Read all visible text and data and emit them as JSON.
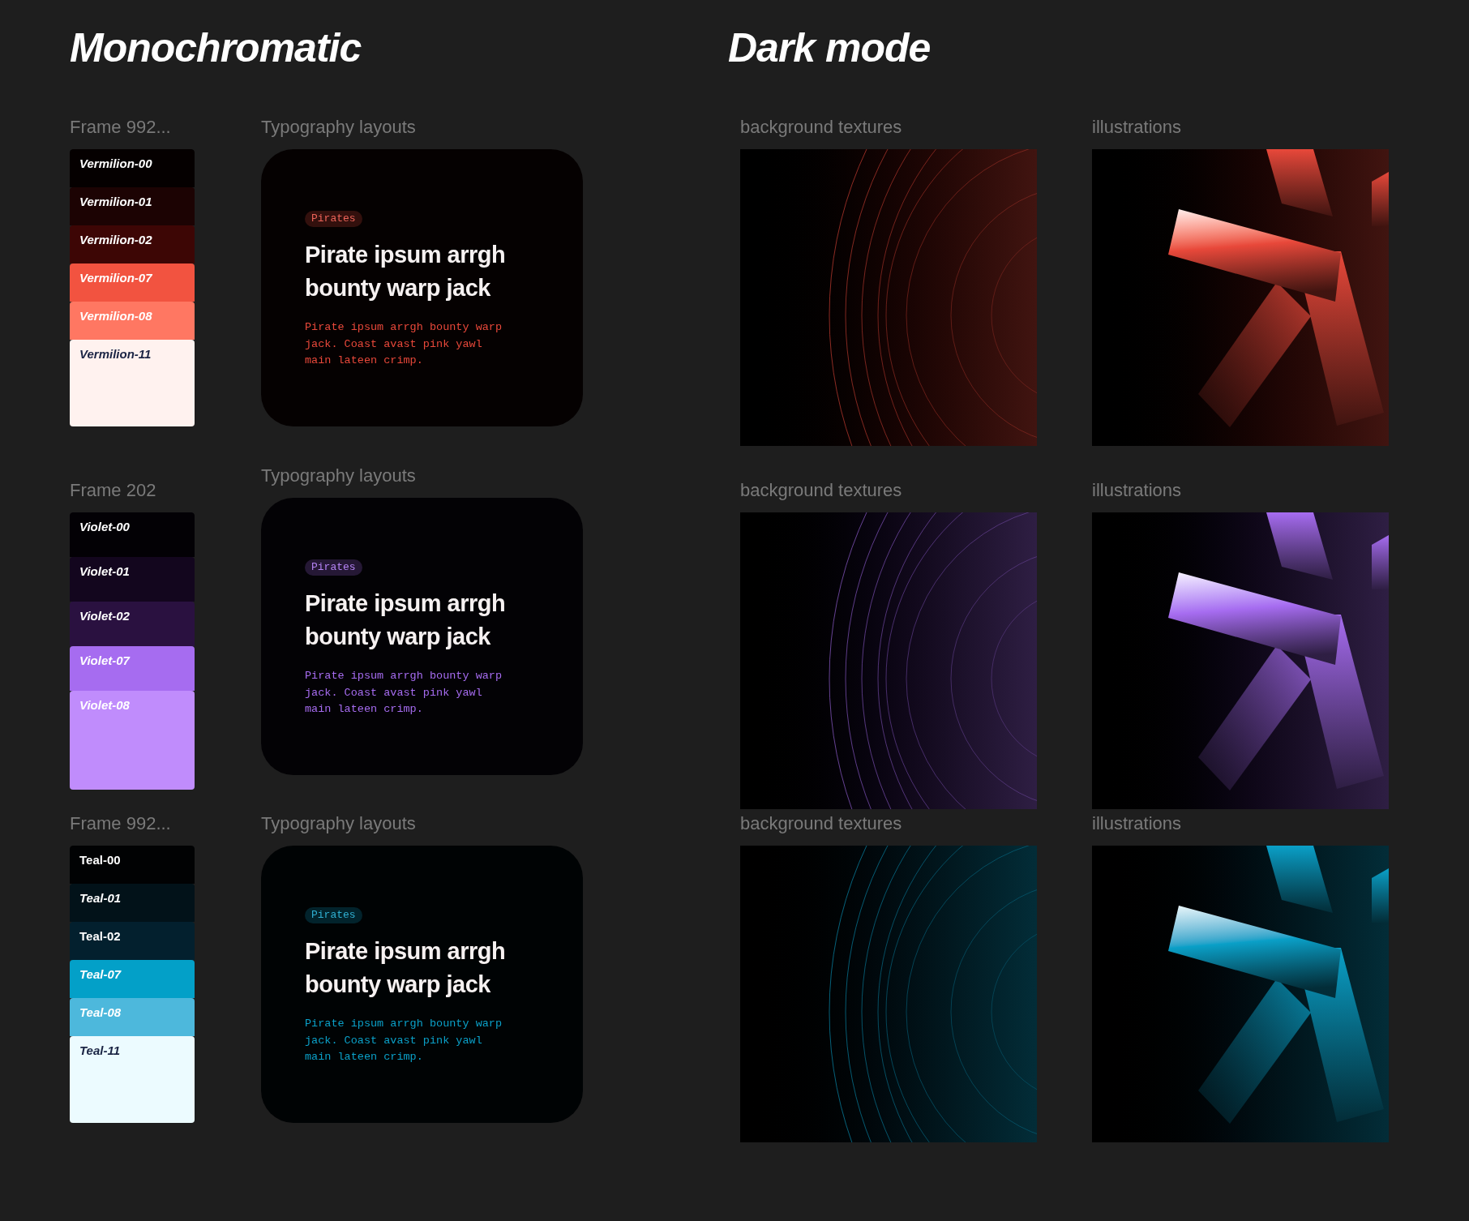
{
  "headings": [
    "Monochromatic",
    "Dark mode"
  ],
  "rows": [
    {
      "frame_label": "Frame 992...",
      "typography_label": "Typography layouts",
      "textures_label": "background textures",
      "illustrations_label": "illustrations",
      "color": "#e8483a",
      "swatches": [
        {
          "label": "Vermilion-00",
          "color": "#050000",
          "dark_label": false,
          "italic": true
        },
        {
          "label": "Vermilion-01",
          "color": "#1c0303",
          "dark_label": false,
          "italic": true
        },
        {
          "label": "Vermilion-02",
          "color": "#3d0605",
          "dark_label": false,
          "italic": true
        },
        {
          "label": "Vermilion-07",
          "color": "#f25340",
          "dark_label": false,
          "italic": true
        },
        {
          "label": "Vermilion-08",
          "color": "#ff7762",
          "dark_label": false,
          "italic": true
        },
        {
          "label": "Vermilion-11",
          "color": "#fff2ef",
          "dark_label": true,
          "italic": true
        }
      ],
      "card": {
        "tag": "Pirates",
        "heading": "Pirate ipsum arrgh bounty warp jack",
        "body": "Pirate ipsum arrgh bounty warp jack. Coast avast pink yawl main lateen crimp."
      }
    },
    {
      "frame_label": "Frame 202",
      "typography_label": "Typography layouts",
      "textures_label": "background textures",
      "illustrations_label": "illustrations",
      "color": "#a66cf0",
      "swatches": [
        {
          "label": "Violet-00",
          "color": "#030105",
          "dark_label": false,
          "italic": true
        },
        {
          "label": "Violet-01",
          "color": "#13061e",
          "dark_label": false,
          "italic": true
        },
        {
          "label": "Violet-02",
          "color": "#2a1140",
          "dark_label": false,
          "italic": true
        },
        {
          "label": "Violet-07",
          "color": "#a66cf0",
          "dark_label": false,
          "italic": true
        },
        {
          "label": "Violet-08",
          "color": "#c08cfc",
          "dark_label": false,
          "italic": true
        }
      ],
      "card": {
        "tag": "Pirates",
        "heading": "Pirate ipsum arrgh bounty warp jack",
        "body": "Pirate ipsum arrgh bounty warp jack. Coast avast pink yawl main lateen crimp."
      }
    },
    {
      "frame_label": "Frame 992...",
      "typography_label": "Typography layouts",
      "textures_label": "background textures",
      "illustrations_label": "illustrations",
      "color": "#0aa0c8",
      "swatches": [
        {
          "label": "Teal-00",
          "color": "#010203",
          "dark_label": false,
          "italic": false
        },
        {
          "label": "Teal-01",
          "color": "#021219",
          "dark_label": false,
          "italic": true
        },
        {
          "label": "Teal-02",
          "color": "#03202e",
          "dark_label": false,
          "italic": false
        },
        {
          "label": "Teal-07",
          "color": "#03a0c8",
          "dark_label": false,
          "italic": true
        },
        {
          "label": "Teal-08",
          "color": "#4db8dc",
          "dark_label": false,
          "italic": true
        },
        {
          "label": "Teal-11",
          "color": "#ecfbff",
          "dark_label": true,
          "italic": true
        }
      ],
      "card": {
        "tag": "Pirates",
        "heading": "Pirate ipsum arrgh bounty warp jack",
        "body": "Pirate ipsum arrgh bounty warp jack. Coast avast pink yawl main lateen crimp."
      }
    }
  ]
}
